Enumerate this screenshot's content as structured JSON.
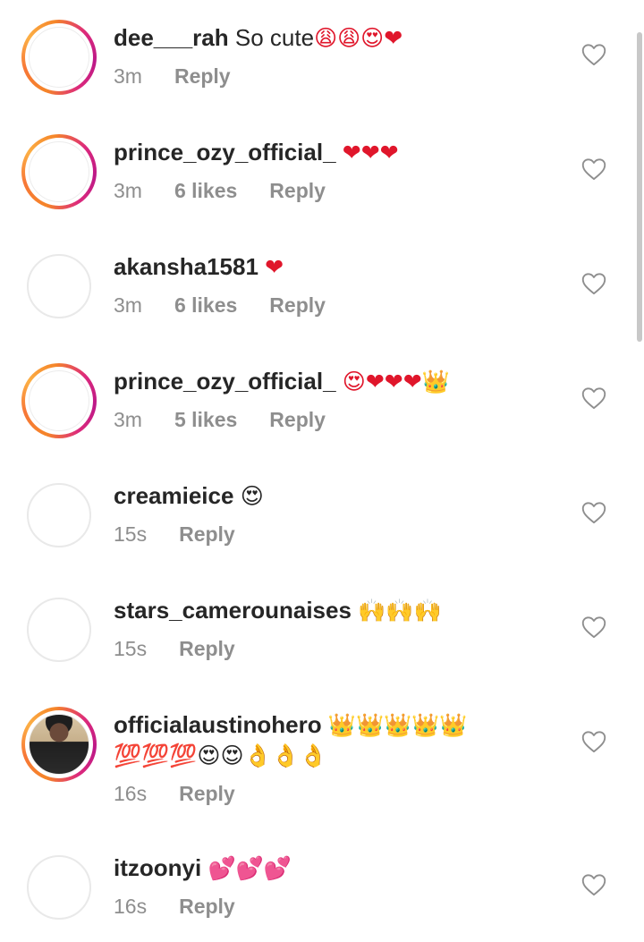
{
  "comments": [
    {
      "user": "dee___rah",
      "text": "So cute",
      "emoji": "😩😩😍❤",
      "time": "3m",
      "likes": "",
      "reply": "Reply",
      "avatar": "ring"
    },
    {
      "user": "prince_ozy_official_",
      "text": "",
      "emoji": "❤❤❤",
      "time": "3m",
      "likes": "6 likes",
      "reply": "Reply",
      "avatar": "ring"
    },
    {
      "user": "akansha1581",
      "text": "",
      "emoji": "❤",
      "time": "3m",
      "likes": "6 likes",
      "reply": "Reply",
      "avatar": "plain"
    },
    {
      "user": "prince_ozy_official_",
      "text": "",
      "emoji": "😍❤❤❤👑",
      "time": "3m",
      "likes": "5 likes",
      "reply": "Reply",
      "avatar": "ring"
    },
    {
      "user": "creamieice",
      "text": "",
      "emoji": "😍",
      "time": "15s",
      "likes": "",
      "reply": "Reply",
      "avatar": "plain"
    },
    {
      "user": "stars_camerounaises",
      "text": "",
      "emoji": "🙌🙌🙌",
      "time": "15s",
      "likes": "",
      "reply": "Reply",
      "avatar": "plain"
    },
    {
      "user": "officialaustinohero",
      "text": "",
      "emoji": "👑👑👑👑👑",
      "emoji2": "💯💯💯😍😍👌👌👌",
      "time": "16s",
      "likes": "",
      "reply": "Reply",
      "avatar": "photo"
    },
    {
      "user": "itzoonyi",
      "text": "",
      "emoji": "💕💕💕",
      "time": "16s",
      "likes": "",
      "reply": "Reply",
      "avatar": "plain"
    }
  ],
  "icons": {
    "like": "heart-outline-icon"
  },
  "colors": {
    "ring_start": "#f58529",
    "ring_end": "#dd2a7b",
    "heart_red": "#e0162b",
    "meta_gray": "#8e8e8e"
  }
}
